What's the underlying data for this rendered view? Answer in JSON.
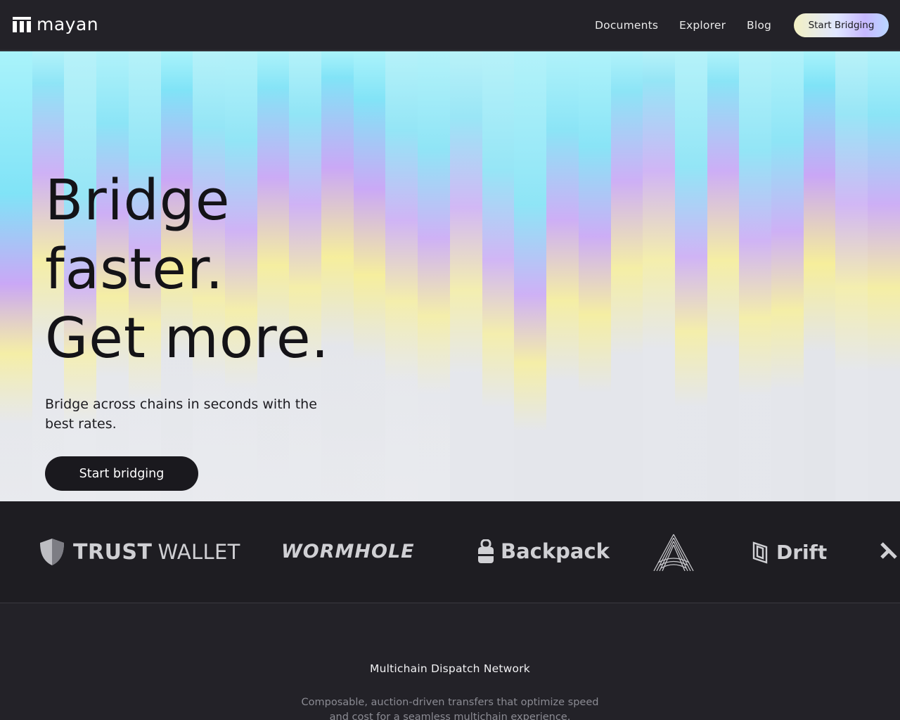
{
  "nav": {
    "brand": "mayan",
    "links": [
      "Documents",
      "Explorer",
      "Blog"
    ],
    "cta": "Start Bridging"
  },
  "hero": {
    "headline": [
      "Bridge",
      "faster.",
      "Get more."
    ],
    "subline": "Bridge across chains in seconds with the best rates.",
    "button": "Start bridging"
  },
  "partners": {
    "trust_wallet": {
      "bold": "TRUST",
      "light": "WALLET"
    },
    "wormhole": "WORMHOLE",
    "backpack": "Backpack",
    "drift": "Drift",
    "icons": [
      "trust-wallet-shield-icon",
      "backpack-lock-icon",
      "aptos-a-icon",
      "drift-icon",
      "chevron-right-logo-icon"
    ]
  },
  "section": {
    "title": "Multichain Dispatch Network",
    "description": "Composable, auction-driven transfers that optimize speed and cost for a seamless multichain experience."
  },
  "colors": {
    "background": "#232228",
    "nav_bg": "#232228",
    "partners_bg": "#1e1d22",
    "hero_button": "#1a191e",
    "stripe_palette": [
      "#a8f3fb",
      "#7ee3f7",
      "#c9a6f6",
      "#f6ee9a",
      "#e3e5ea"
    ]
  }
}
